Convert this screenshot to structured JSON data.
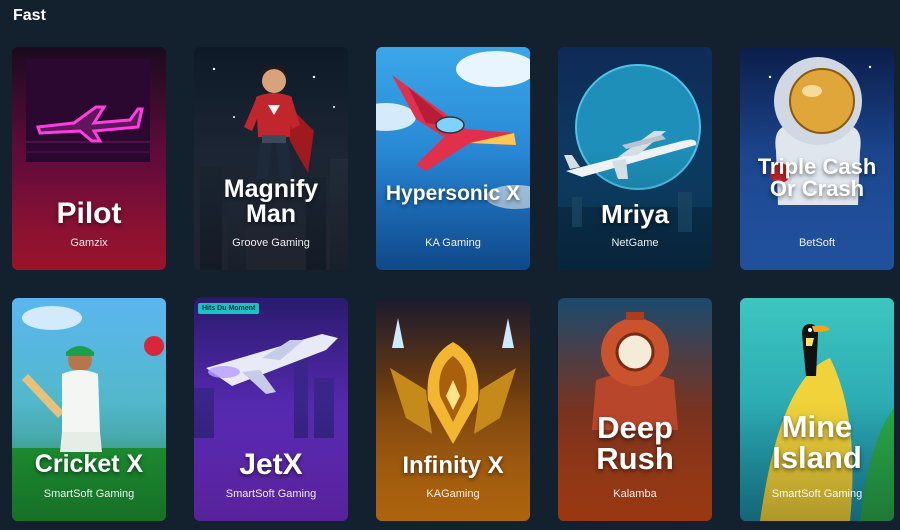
{
  "section": {
    "title": "Fast"
  },
  "colors": {
    "page_background": "#13202d",
    "badge_background": "#19c2c7"
  },
  "games": [
    {
      "title": "Pilot",
      "provider": "Gamzix",
      "art_icon": "neon-airplane-icon",
      "background": "magenta-red"
    },
    {
      "title": "Magnify Man",
      "provider": "Groove Gaming",
      "art_icon": "superhero-icon",
      "background": "night-city"
    },
    {
      "title": "Hypersonic X",
      "provider": "KA Gaming",
      "art_icon": "fighter-jet-icon",
      "background": "sky-blue"
    },
    {
      "title": "Mriya",
      "provider": "NetGame",
      "art_icon": "cargo-plane-icon",
      "background": "deep-blue"
    },
    {
      "title": "Triple Cash Or Crash",
      "provider": "BetSoft",
      "art_icon": "astronaut-icon",
      "background": "space-blue"
    },
    {
      "title": "Cricket X",
      "provider": "SmartSoft Gaming",
      "art_icon": "cricket-player-icon",
      "background": "green-pitch"
    },
    {
      "title": "JetX",
      "provider": "SmartSoft Gaming",
      "art_icon": "jet-icon",
      "background": "purple",
      "badge": "Hits Du Moment"
    },
    {
      "title": "Infinity X",
      "provider": "KAGaming",
      "art_icon": "golden-ship-icon",
      "background": "orange"
    },
    {
      "title": "Deep Rush",
      "provider": "Kalamba",
      "art_icon": "diver-icon",
      "background": "red-orange"
    },
    {
      "title": "Mine Island",
      "provider": "SmartSoft Gaming",
      "art_icon": "toucan-icon",
      "background": "teal-yellow"
    }
  ]
}
